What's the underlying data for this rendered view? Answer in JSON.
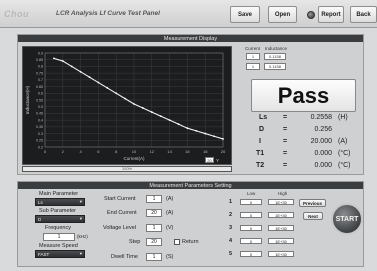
{
  "header": {
    "logo": "Chou",
    "title": "LCR Analysis Lf Curve Test Panel",
    "buttons": {
      "save": "Save",
      "open": "Open",
      "report": "Report",
      "back": "Back"
    }
  },
  "display": {
    "title": "Measurement Display",
    "progress_label": "100%",
    "progress_pct": 100,
    "current_header": "Current",
    "inductance_header": "Inductance",
    "current_value": "1",
    "inductance_value": "0.1158",
    "current_value2": "1",
    "inductance_value2": "0.1158",
    "cursor_label": "20",
    "cursor_axis": "Y",
    "result": "Pass",
    "readouts": [
      {
        "label": "Ls",
        "value": "0.2558",
        "unit": "(H)"
      },
      {
        "label": "D",
        "value": "0.256",
        "unit": ""
      },
      {
        "label": "I",
        "value": "20.000",
        "unit": "(A)"
      },
      {
        "label": "T1",
        "value": "0.000",
        "unit": "(°C)"
      },
      {
        "label": "T2",
        "value": "0.000",
        "unit": "(°C)"
      }
    ]
  },
  "chart_data": {
    "type": "line",
    "xlabel": "Current(A)",
    "ylabel": "Inductance(H)",
    "xlim": [
      0,
      20
    ],
    "ylim": [
      0.2,
      0.9
    ],
    "x_ticks": [
      "0",
      "2",
      "4",
      "6",
      "8",
      "10",
      "12",
      "14",
      "16",
      "18",
      "20"
    ],
    "y_ticks": [
      "0.9",
      "0.85",
      "0.8",
      "0.75",
      "0.7",
      "0.65",
      "0.6",
      "0.55",
      "0.5",
      "0.45",
      "0.4",
      "0.35",
      "0.3",
      "0.25",
      "0.2"
    ],
    "series": [
      {
        "x": [
          1,
          2,
          3,
          4,
          5,
          6,
          7,
          8,
          9,
          10,
          11,
          12,
          13,
          14,
          15,
          16,
          17,
          18,
          19,
          20
        ],
        "values": [
          0.86,
          0.84,
          0.8,
          0.76,
          0.72,
          0.68,
          0.64,
          0.6,
          0.56,
          0.52,
          0.49,
          0.46,
          0.43,
          0.4,
          0.37,
          0.34,
          0.32,
          0.3,
          0.28,
          0.26
        ]
      }
    ],
    "grid": true
  },
  "params": {
    "title": "Measurement Parameters Setting",
    "main_parameter_label": "Main Parameter",
    "main_parameter_value": "Ls",
    "sub_parameter_label": "Sub Parameter",
    "sub_parameter_value": "D",
    "frequency_label": "Frequency",
    "frequency_value": "1",
    "frequency_unit": "(kHz)",
    "speed_label": "Measure Speed",
    "speed_value": "FAST",
    "start_current_label": "Start Current",
    "start_current_value": "1",
    "start_current_unit": "(A)",
    "end_current_label": "End Current",
    "end_current_value": "20",
    "end_current_unit": "(A)",
    "voltage_label": "Voltage Level",
    "voltage_value": "1",
    "voltage_unit": "(V)",
    "step_label": "Step",
    "step_value": "20",
    "return_label": "Return",
    "dwell_label": "Dwell Time",
    "dwell_value": "1",
    "dwell_unit": "(S)",
    "limits_low_header": "Low",
    "limits_high_header": "High",
    "limits": [
      {
        "n": "1",
        "low": "0",
        "high": "1E+30"
      },
      {
        "n": "2",
        "low": "0",
        "high": "1E+30"
      },
      {
        "n": "3",
        "low": "0",
        "high": "1E+30"
      },
      {
        "n": "4",
        "low": "0",
        "high": "1E+30"
      },
      {
        "n": "5",
        "low": "0",
        "high": "1E+30"
      }
    ],
    "previous_label": "Previous",
    "next_label": "Next",
    "start_label": "START"
  }
}
